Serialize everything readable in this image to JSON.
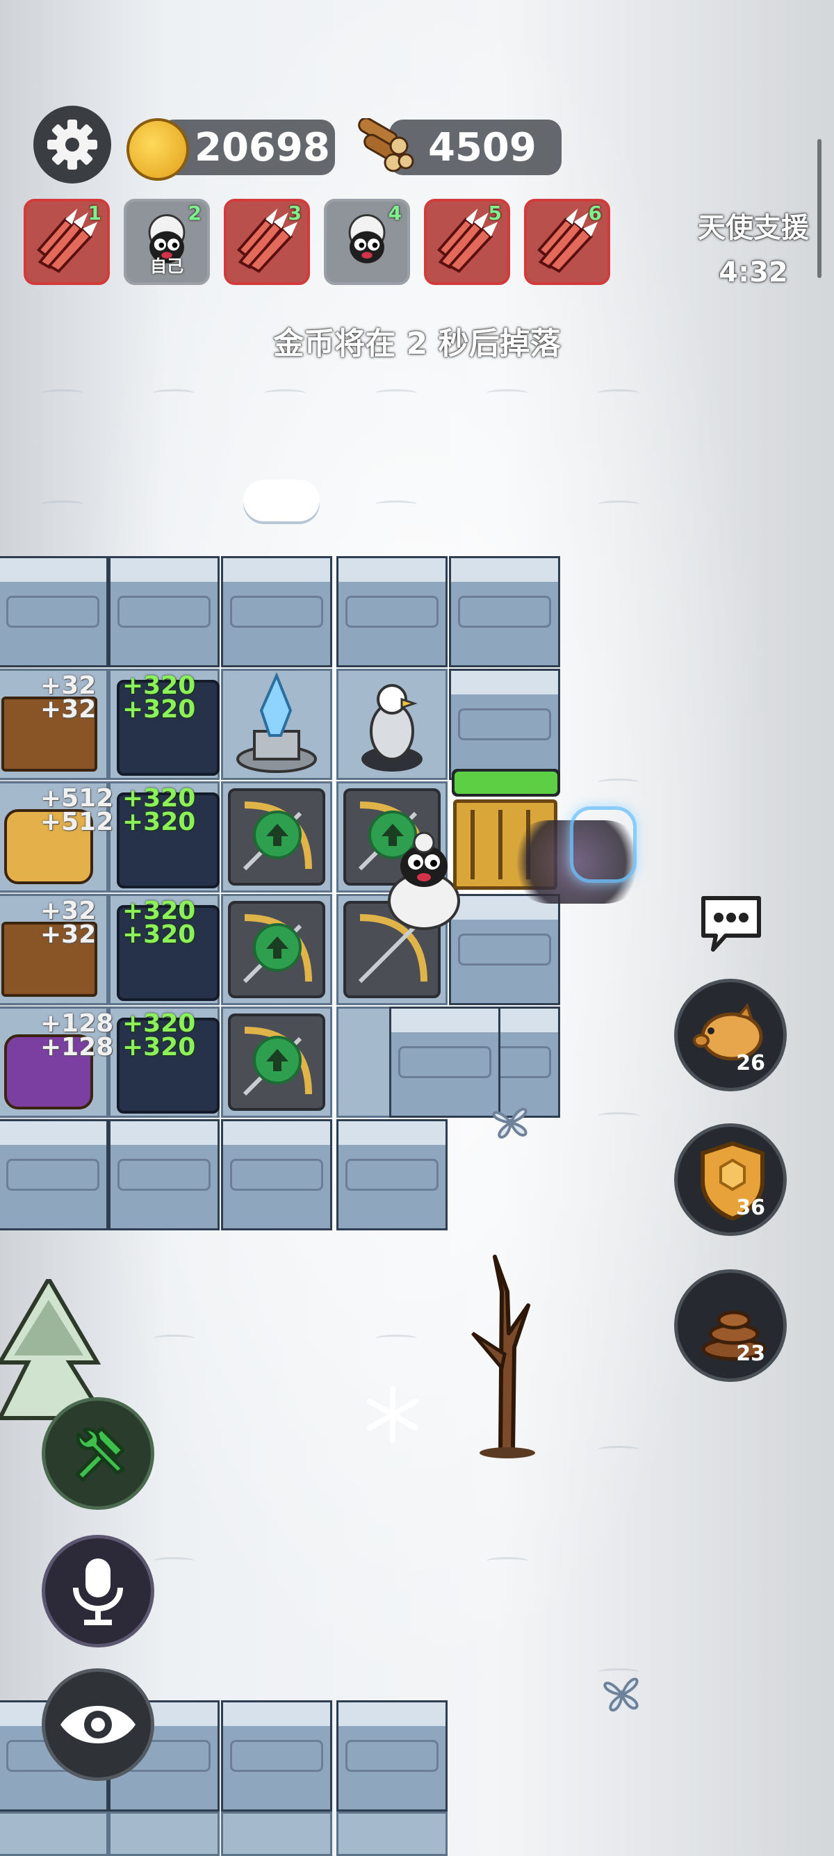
{
  "hud": {
    "gold": "20698",
    "wood": "4509",
    "status_message": "金币将在 2 秒后掉落",
    "angel_support_label": "天使支援",
    "angel_support_timer": "4:32"
  },
  "players": [
    {
      "num": "1",
      "avatar": "red-claw",
      "caption": ""
    },
    {
      "num": "2",
      "avatar": "sheep",
      "caption": "自己"
    },
    {
      "num": "3",
      "avatar": "red-claw",
      "caption": ""
    },
    {
      "num": "4",
      "avatar": "sheep",
      "caption": ""
    },
    {
      "num": "5",
      "avatar": "red-claw",
      "caption": ""
    },
    {
      "num": "6",
      "avatar": "red-claw-open",
      "caption": ""
    }
  ],
  "board": {
    "gains": [
      {
        "left_a": "+32",
        "left_b": "+32",
        "right_a": "+320",
        "right_b": "+320"
      },
      {
        "left_a": "+512",
        "left_b": "+512",
        "right_a": "+320",
        "right_b": "+320"
      },
      {
        "left_a": "+32",
        "left_b": "+32",
        "right_a": "+320",
        "right_b": "+320"
      },
      {
        "left_a": "+128",
        "left_b": "+128",
        "right_a": "+320",
        "right_b": "+320"
      }
    ],
    "door_health": 1.0
  },
  "abilities": [
    {
      "name": "piggy-bank",
      "count": "26"
    },
    {
      "name": "shield",
      "count": "36"
    },
    {
      "name": "poop",
      "count": "23"
    }
  ],
  "colors": {
    "accent_green": "#8cf05a",
    "slot_red": "#d23b3b",
    "upgrade_green": "#2e9e4f"
  }
}
